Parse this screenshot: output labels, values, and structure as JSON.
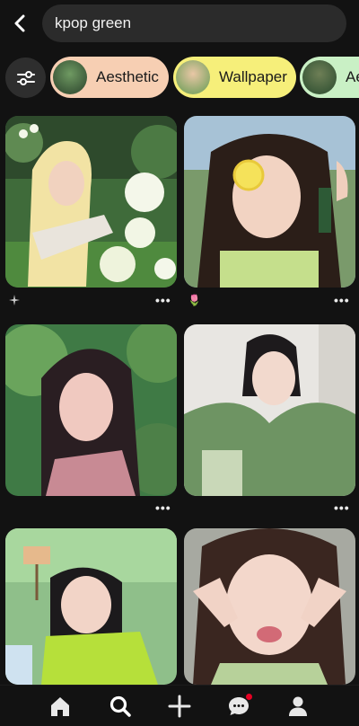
{
  "search": {
    "query": "kpop green"
  },
  "chips": [
    {
      "label": "Aesthetic",
      "color": "#f7cfb3"
    },
    {
      "label": "Wallpaper",
      "color": "#f6ef7a"
    },
    {
      "label": "Ae",
      "color": "#c9f0c5"
    }
  ],
  "pins": [
    {
      "caption": "",
      "has_more": true
    },
    {
      "caption": "🌷",
      "has_more": true
    },
    {
      "caption": "",
      "has_more": true
    },
    {
      "caption": "",
      "has_more": true
    },
    {
      "caption": "",
      "has_more": false
    },
    {
      "caption": "",
      "has_more": false
    }
  ],
  "more_glyph": "•••",
  "nav": {
    "items": [
      "home",
      "search",
      "create",
      "messages",
      "profile"
    ],
    "active": "search",
    "notification_color": "#e60023"
  },
  "colors": {
    "background": "#121212",
    "search_bg": "#2b2b2b"
  }
}
